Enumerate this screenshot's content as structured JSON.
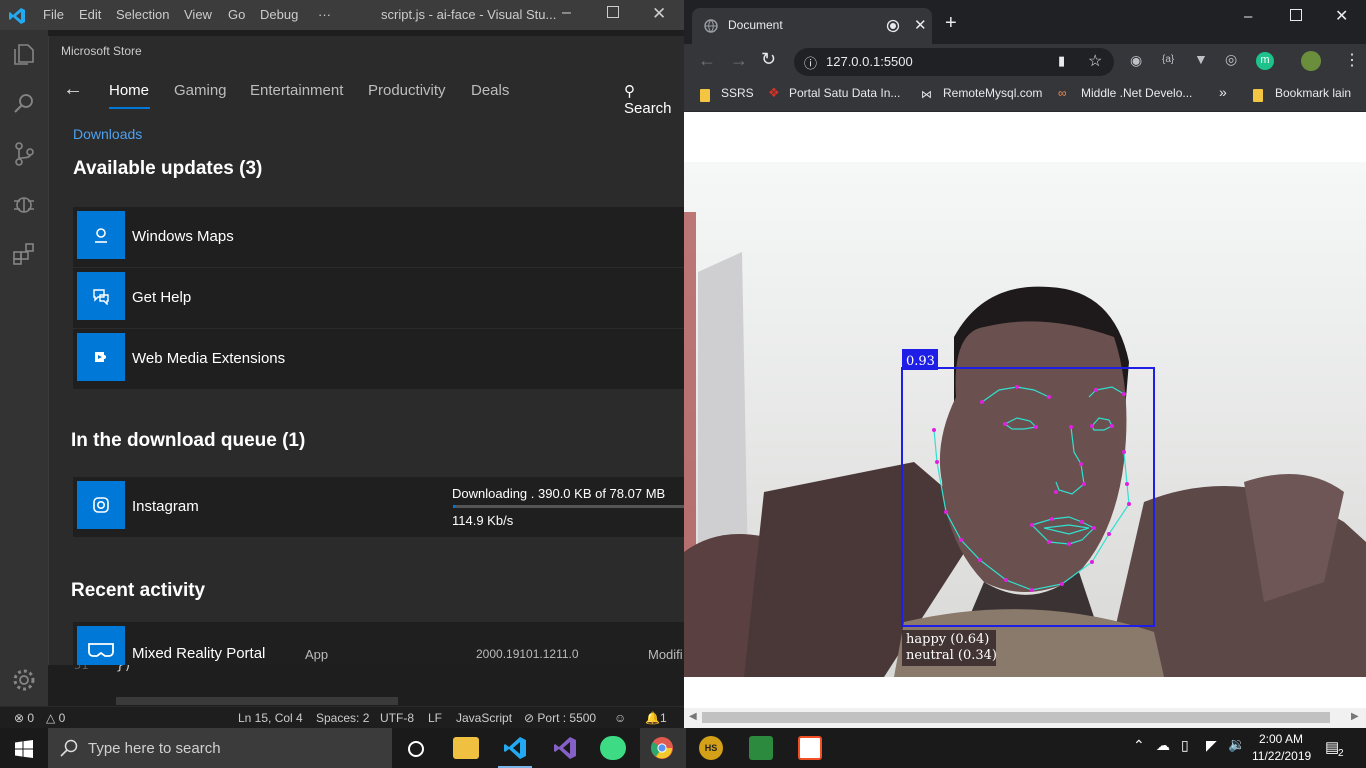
{
  "vscode": {
    "menu": [
      "File",
      "Edit",
      "Selection",
      "View",
      "Go",
      "Debug",
      "···"
    ],
    "title": "script.js - ai-face - Visual Stu...",
    "code_line_number": "51",
    "code_text": "})",
    "status": {
      "errors": "0",
      "warnings": "0",
      "position": "Ln 15, Col 4",
      "spaces": "Spaces: 2",
      "encoding": "UTF-8",
      "eol": "LF",
      "language": "JavaScript",
      "port": "Port : 5500",
      "notifications": "1"
    }
  },
  "store": {
    "title": "Microsoft Store",
    "nav": [
      "Home",
      "Gaming",
      "Entertainment",
      "Productivity",
      "Deals"
    ],
    "search_label": "Search",
    "downloads_link": "Downloads",
    "updates_heading": "Available updates (3)",
    "updates": [
      "Windows Maps",
      "Get Help",
      "Web Media Extensions"
    ],
    "queue_heading": "In the download queue (1)",
    "queue_item": {
      "name": "Instagram",
      "status": "Downloading . 390.0 KB of 78.07 MB",
      "speed": "114.9 Kb/s",
      "progress": 0.005
    },
    "recent_heading": "Recent activity",
    "recent_item": {
      "name": "Mixed Reality Portal",
      "type": "App",
      "version": "2000.19101.1211.0",
      "extra": "Modifi"
    }
  },
  "chrome": {
    "tab_title": "Document",
    "url": "127.0.0.1:5500",
    "bookmarks": [
      "SSRS",
      "Portal Satu Data In...",
      "RemoteMysql.com",
      "Middle .Net Develo...",
      "Bookmark lain"
    ],
    "profile_letter": "m",
    "overflow": "»",
    "detection": {
      "score": "0.93",
      "expressions": [
        "happy (0.64)",
        "neutral (0.34)"
      ]
    }
  },
  "taskbar": {
    "search_placeholder": "Type here to search",
    "time": "2:00 AM",
    "date": "11/22/2019",
    "notification_count": "2",
    "hs_label": "HS"
  },
  "colors": {
    "vscode_title": "#3c3c3c",
    "vscode_activity": "#333333",
    "store_bg": "#2b2b2b",
    "accent": "#0078d7",
    "chrome_frame": "#35363a",
    "detection_box": "#1e1ee6",
    "landmarks": "#e020e0",
    "landmark_lines": "#30e0d0"
  }
}
